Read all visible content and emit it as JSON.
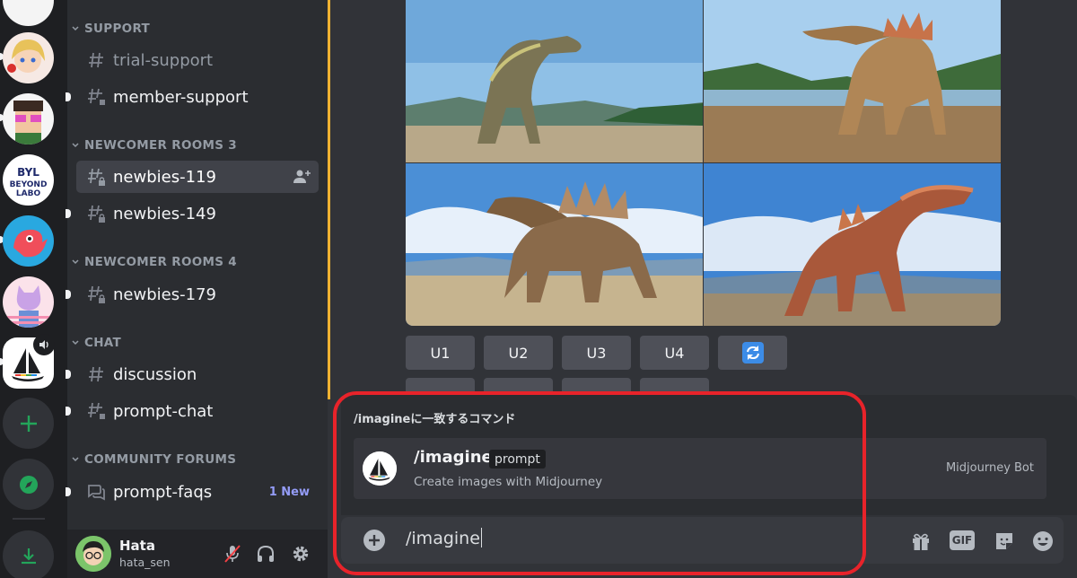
{
  "servers": [
    {
      "name": "cloud-avatar"
    },
    {
      "name": "anime-girl-avatar"
    },
    {
      "name": "glasses-avatar"
    },
    {
      "name": "beyond-labo-logo"
    },
    {
      "name": "bird-avatar"
    },
    {
      "name": "cat-avatar"
    },
    {
      "name": "midjourney-logo"
    }
  ],
  "sidebar": {
    "categories": {
      "support": "SUPPORT",
      "newcomer3": "NEWCOMER ROOMS 3",
      "newcomer4": "NEWCOMER ROOMS 4",
      "chat": "CHAT",
      "forums": "COMMUNITY FORUMS"
    },
    "channels": {
      "trial_support": "trial-support",
      "member_support": "member-support",
      "newbies_119": "newbies-119",
      "newbies_149": "newbies-149",
      "newbies_179": "newbies-179",
      "discussion": "discussion",
      "prompt_chat": "prompt-chat",
      "prompt_faqs": "prompt-faqs"
    },
    "forum_badge": "1 New"
  },
  "user": {
    "name": "Hata",
    "tag": "hata_sen"
  },
  "message": {
    "upscale_buttons": [
      "U1",
      "U2",
      "U3",
      "U4"
    ]
  },
  "autocomplete": {
    "title": "/imagineに一致するコマンド",
    "command": "/imagine",
    "option": "prompt",
    "description": "Create images with Midjourney",
    "bot": "Midjourney Bot"
  },
  "input": {
    "value": "/imagine"
  },
  "colors": {
    "accent": "#5865f2",
    "highlight": "#e8232a",
    "mention": "#f0b232"
  }
}
